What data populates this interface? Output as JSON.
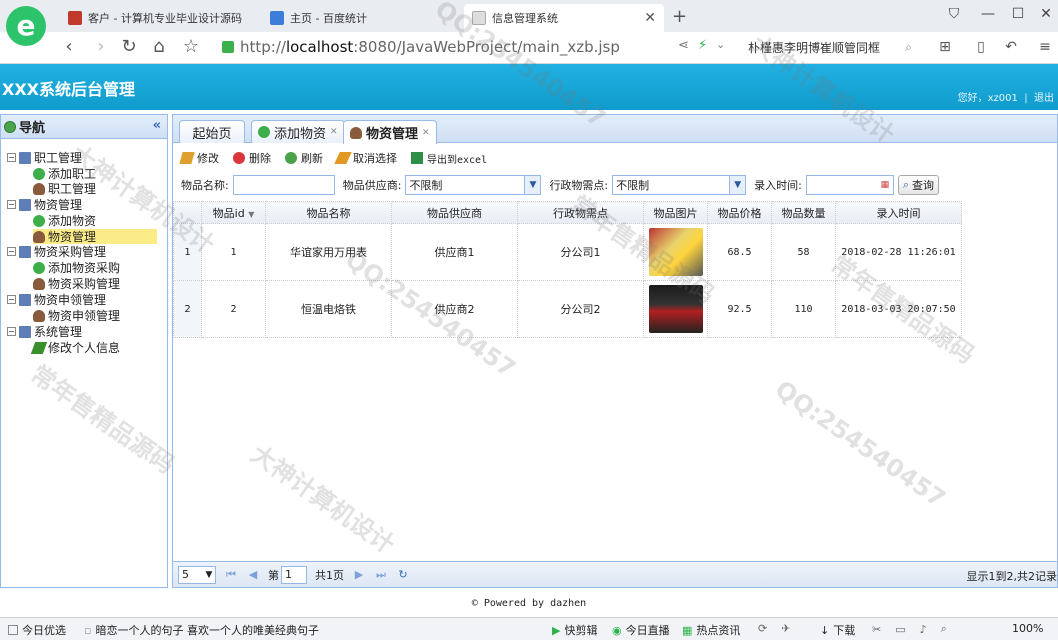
{
  "browser": {
    "tabs": [
      {
        "label": "客户 - 计算机专业毕业设计源码"
      },
      {
        "label": "主页 - 百度统计"
      },
      {
        "label": "信息管理系统"
      }
    ],
    "new_tab": "+",
    "url_prefix": "http://",
    "url_host": "localhost",
    "url_rest": ":8080/JavaWebProject/main_xzb.jsp",
    "search_text": "朴槿惠李明博崔顺管同框"
  },
  "app": {
    "title": "XXX系统后台管理",
    "user_greeting": "您好，xz001",
    "separator": "|",
    "logout": "退出"
  },
  "nav": {
    "title": "导航",
    "items": [
      {
        "label": "职工管理"
      },
      {
        "label": "添加职工"
      },
      {
        "label": "职工管理"
      },
      {
        "label": "物资管理"
      },
      {
        "label": "添加物资"
      },
      {
        "label": "物资管理"
      },
      {
        "label": "物资采购管理"
      },
      {
        "label": "添加物资采购"
      },
      {
        "label": "物资采购管理"
      },
      {
        "label": "物资申领管理"
      },
      {
        "label": "物资申领管理"
      },
      {
        "label": "系统管理"
      },
      {
        "label": "修改个人信息"
      }
    ]
  },
  "content_tabs": [
    {
      "label": "起始页"
    },
    {
      "label": "添加物资"
    },
    {
      "label": "物资管理"
    }
  ],
  "toolbar": {
    "edit": "修改",
    "delete": "删除",
    "refresh": "刷新",
    "cancel_select": "取消选择",
    "export": "导出到excel"
  },
  "search": {
    "name_label": "物品名称:",
    "name_value": "",
    "supplier_label": "物品供应商:",
    "supplier_value": "不限制",
    "dept_label": "行政物需点:",
    "dept_value": "不限制",
    "time_label": "录入时间:",
    "time_value": "",
    "query": "查询"
  },
  "grid": {
    "columns": [
      "物品id",
      "物品名称",
      "物品供应商",
      "行政物需点",
      "物品图片",
      "物品价格",
      "物品数量",
      "录入时间"
    ],
    "rows": [
      {
        "rn": "1",
        "id": "1",
        "name": "华谊家用万用表",
        "supplier": "供应商1",
        "dept": "分公司1",
        "price": "68.5",
        "qty": "58",
        "time": "2018-02-28 11:26:01"
      },
      {
        "rn": "2",
        "id": "2",
        "name": "恒温电烙铁",
        "supplier": "供应商2",
        "dept": "分公司2",
        "price": "92.5",
        "qty": "110",
        "time": "2018-03-03 20:07:50"
      }
    ]
  },
  "pager": {
    "page_size": "5",
    "page_prefix": "第",
    "page_value": "1",
    "page_suffix": "共1页",
    "info": "显示1到2,共2记录"
  },
  "footer": "© Powered by dazhen",
  "statusbar": {
    "left": "今日优选",
    "news": "暗恋一个人的句子 喜欢一个人的唯美经典句子",
    "quick_edit": "快剪辑",
    "live": "今日直播",
    "hot": "热点资讯",
    "download": "下载",
    "zoom": "100%"
  },
  "watermarks": [
    "QQ:254540457",
    "大神计算机设计",
    "常年售精品源码"
  ]
}
